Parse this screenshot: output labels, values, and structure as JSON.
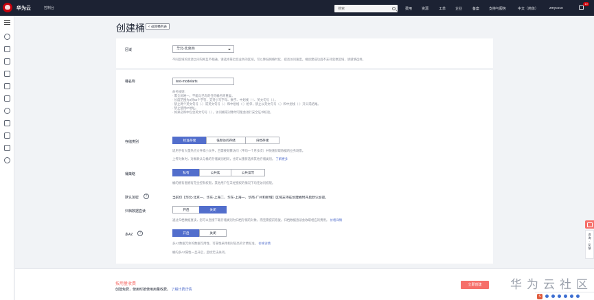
{
  "topbar": {
    "brand": "华为云",
    "console": "控制台",
    "search_placeholder": "搜索",
    "nav": [
      "费用",
      "资源",
      "工单",
      "企业",
      "备案",
      "支持与服务",
      "中文（简体）",
      "zmycoco"
    ],
    "badge": "10"
  },
  "page": {
    "title": "创建桶",
    "back_label": "< 返回桶列表"
  },
  "form": {
    "region_label": "区域",
    "region_value": "华北-北京四",
    "region_hint": "不同区域的资源之间内网互不相通，请选择靠近您业务的区域，可以降低网络时延、提高访问速度。桶创建成功后不支持变更区域，请谨慎选择。",
    "bucket_name_label": "桶名称",
    "bucket_name_value": "test-modelarts",
    "rules": [
      "命名规则:",
      "· 需全局唯一，不能与已有的任何桶名称重复。",
      "· 长度范围为3到63个字符，支持小写字母、数字、中划线（-）、英文句号（.）。",
      "· 禁止两个英文句号（.）或英文句号（.）和中划线（-）相邻，禁止以英文句号（.）和中划线（-）开头或结尾。",
      "· 禁止使用IP地址。",
      "· 如果名称中包含英文句号（.），访问桶或对象时可能会进行安全证书校验。"
    ],
    "storage_label": "存储类别",
    "storage_options": [
      "标准存储",
      "低频访问存储",
      "归档存储"
    ],
    "storage_hint": "适用于有大量热点文件或小文件，且需要频繁访问（平均一个月多次）并快速获取数据的业务场景。",
    "storage_hint2": "上传对象时，对象默认与桶的存储类别相同，也可以重新选择其他存储类别。",
    "storage_link": "了解更多",
    "policy_label": "桶策略",
    "policy_options": [
      "私有",
      "公共读",
      "公共读写"
    ],
    "policy_hint": "桶的拥有者拥有完全控制权限，其他用户在未经授权的情况下均无访问权限。",
    "replica_label": "默认加密",
    "replica_text": "当前仅【华北-北京一、华东-上海二、华东-上海一、华南-广州和新增】区域支持在创建桶时开启默认加密。",
    "archive_label": "归档数据直读",
    "archive_options": [
      "开启",
      "关闭"
    ],
    "archive_hint": "通过归档数据直读，您可以直接下载存储类别为归档存储的对象，而无需提前恢复。归档数据直读会收取相应的费用。",
    "archive_link": "价格详情",
    "multiaz_label": "多AZ",
    "multiaz_options": [
      "开启",
      "关闭"
    ],
    "multiaz_hint": "多AZ数据冗余的数据可用性、可靠性采用相对较高的计费标准。",
    "multiaz_link": "价格详情",
    "multiaz_hint2": "桶的多AZ属性一旦开启，后续无法关闭。"
  },
  "bottom": {
    "price_label": "按用量收费",
    "price_sub": "创建免费，使用时按使用用量收费。",
    "price_link": "了解计费详情",
    "buy_label": "立即创建",
    "watermark": "华为云社区"
  },
  "float_panel": "咨\n询\n·\n反\n馈"
}
